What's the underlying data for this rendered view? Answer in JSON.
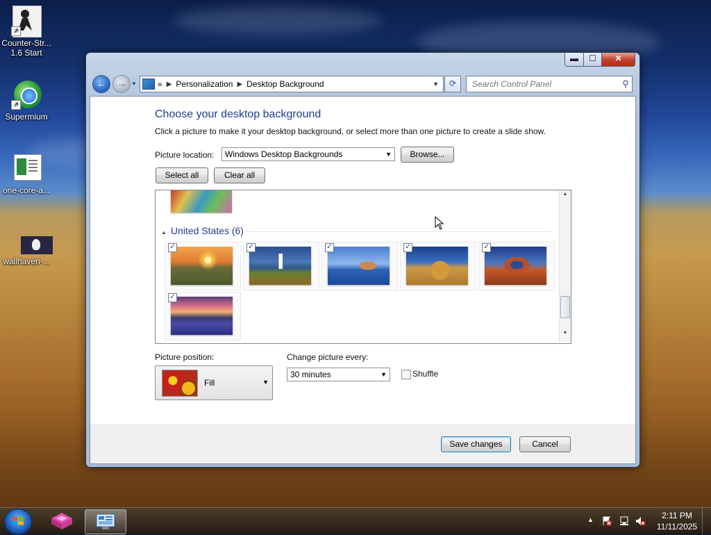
{
  "desktop": {
    "icons": [
      {
        "label": "Counter-Strike 1.6 Start",
        "line1": "Counter-Str...",
        "line2": "1.6 Start"
      },
      {
        "label": "Supermium"
      },
      {
        "label": "one-core-a..."
      },
      {
        "label": "wallhaven-..."
      }
    ]
  },
  "window": {
    "breadcrumb": {
      "root_marker": "«",
      "items": [
        "Personalization",
        "Desktop Background"
      ]
    },
    "search_placeholder": "Search Control Panel",
    "title": "Choose your desktop background",
    "description": "Click a picture to make it your desktop background, or select more than one picture to create a slide show.",
    "picture_location": {
      "label": "Picture location:",
      "value": "Windows Desktop Backgrounds",
      "browse": "Browse..."
    },
    "select_all": "Select all",
    "clear_all": "Clear all",
    "gallery": {
      "group_name": "United States (6)",
      "thumbs": [
        {
          "name": "sunset-plains",
          "checked": true
        },
        {
          "name": "lighthouse",
          "checked": true
        },
        {
          "name": "rock-lake",
          "checked": true
        },
        {
          "name": "hay-bale",
          "checked": true
        },
        {
          "name": "delicate-arch",
          "checked": true
        },
        {
          "name": "lupine-lake",
          "checked": true
        }
      ]
    },
    "picture_position": {
      "label": "Picture position:",
      "value": "Fill"
    },
    "change_picture": {
      "label": "Change picture every:",
      "value": "30 minutes"
    },
    "shuffle": {
      "label": "Shuffle",
      "checked": false
    },
    "save": "Save changes",
    "cancel": "Cancel"
  },
  "taskbar": {
    "clock_time": "2:11 PM",
    "clock_date": "11/11/2025",
    "tray_arrow": "▲"
  }
}
